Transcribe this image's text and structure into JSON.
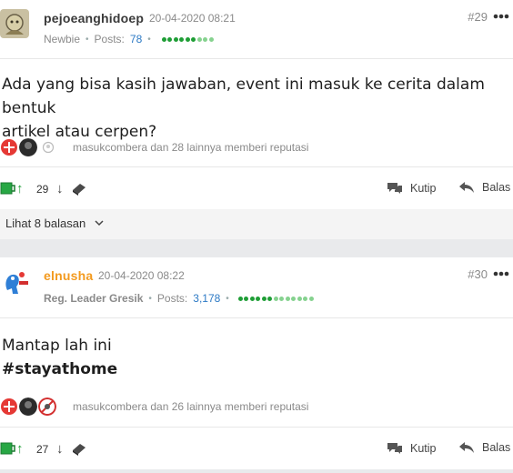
{
  "posts": [
    {
      "username": "pejoeanghidoep",
      "datetime": "20-04-2020 08:21",
      "post_number": "#29",
      "rank": "Newbie",
      "posts_label": "Posts:",
      "posts_count": "78",
      "content_lines": [
        "Ada yang bisa kasih jawaban, event ini masuk ke cerita dalam bentuk",
        "artikel atau cerpen?"
      ],
      "reputation_text": "masukcombera dan 28 lainnya memberi reputasi",
      "vote_count": "29",
      "quote_label": "Kutip",
      "reply_label": "Balas"
    },
    {
      "username": "elnusha",
      "datetime": "20-04-2020 08:22",
      "post_number": "#30",
      "rank": "Reg. Leader Gresik",
      "posts_label": "Posts:",
      "posts_count": "3,178",
      "content_line": "Mantap lah ini",
      "hashtag": "#stayathome",
      "reputation_text": "masukcombera dan 26 lainnya memberi reputasi",
      "vote_count": "27",
      "quote_label": "Kutip",
      "reply_label": "Balas"
    }
  ],
  "thread": {
    "replies_label": "Lihat 8 balasan"
  },
  "icons": {
    "more": "more-dots-icon",
    "cendol": "cendol-icon",
    "up": "arrow-up-icon",
    "down": "arrow-down-icon",
    "bata": "bata-icon",
    "quote": "quote-bubble-icon",
    "reply": "reply-arrow-icon",
    "expand": "chevron-down-icon"
  },
  "colors": {
    "accent_green": "#1f9e36",
    "link_blue": "#2d7ac5",
    "orange_username": "#f39a1f",
    "muted": "#8a8a8a"
  }
}
